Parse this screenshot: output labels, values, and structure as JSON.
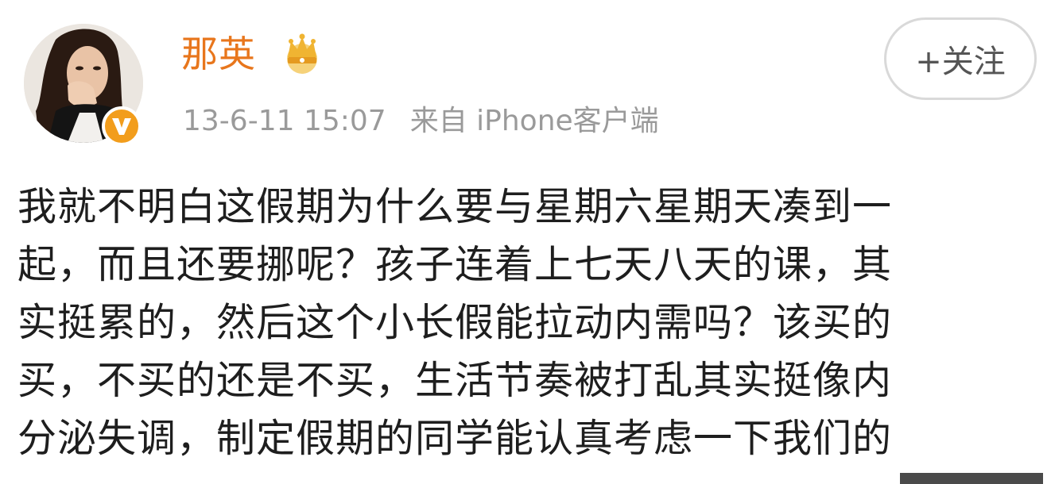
{
  "user": {
    "name": "那英",
    "verified_mark": "V"
  },
  "follow_button": {
    "label": "+关注"
  },
  "post": {
    "time": "13-6-11 15:07",
    "source": "来自 iPhone客户端",
    "lines": [
      "我就不明白这假期为什么要与星期六星期天凑到一",
      "起，而且还要挪呢？孩子连着上七天八天的课，其",
      "实挺累的，然后这个小长假能拉动内需吗？该买的",
      "买，不买的还是不买，生活节奏被打乱其实挺像内",
      "分泌失调，制定假期的同学能认真考虑一下我们的"
    ]
  },
  "icons": {
    "avatar": "user-avatar",
    "verify": "verified-v-icon",
    "crown": "crown-icon"
  },
  "colors": {
    "name": "#e8761c",
    "badge": "#f29d1c",
    "meta": "#9a9a9a",
    "text": "#1e1e1e"
  }
}
